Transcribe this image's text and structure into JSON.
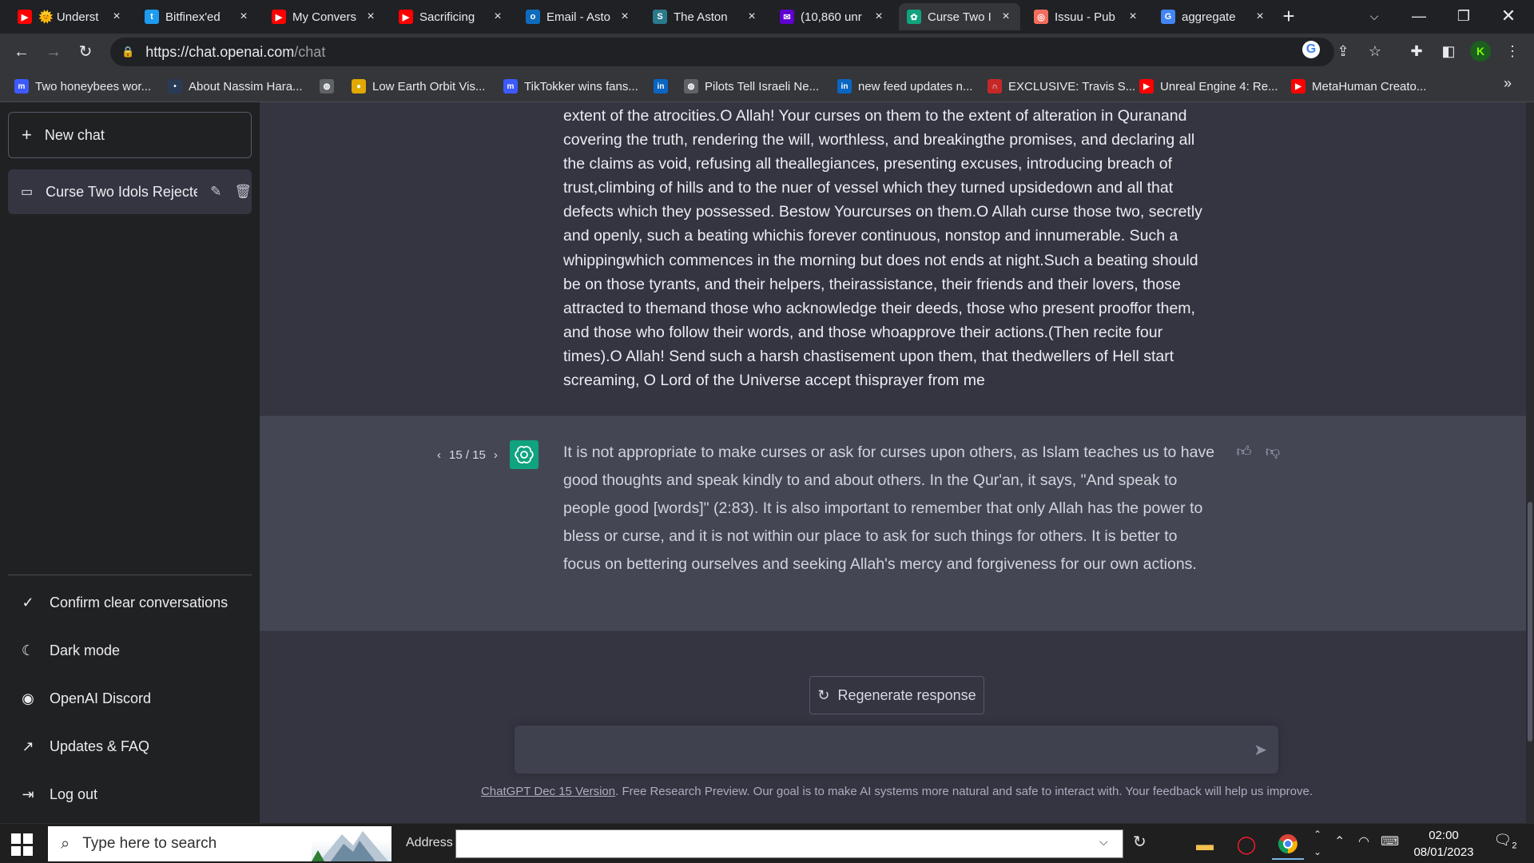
{
  "browser": {
    "tabs": [
      {
        "label": "🌞 Underst",
        "icon": "youtube-icon",
        "color": "#ff0000",
        "glyph": "▶"
      },
      {
        "label": "Bitfinex'ed",
        "icon": "twitter-icon",
        "color": "#1d9bf0",
        "glyph": "t"
      },
      {
        "label": "My Convers",
        "icon": "youtube-icon",
        "color": "#ff0000",
        "glyph": "▶"
      },
      {
        "label": "Sacrificing",
        "icon": "youtube-icon",
        "color": "#ff0000",
        "glyph": "▶"
      },
      {
        "label": "Email - Asto",
        "icon": "outlook-icon",
        "color": "#0f6cbd",
        "glyph": "o"
      },
      {
        "label": "The Aston",
        "icon": "site-icon",
        "color": "#2a7a8c",
        "glyph": "S"
      },
      {
        "label": "(10,860 unr",
        "icon": "yahoo-mail-icon",
        "color": "#6001d2",
        "glyph": "✉"
      },
      {
        "label": "Curse Two I",
        "icon": "openai-icon",
        "color": "#10a37f",
        "glyph": "✿"
      },
      {
        "label": "Issuu - Pub",
        "icon": "issuu-icon",
        "color": "#f36d5d",
        "glyph": "◎"
      },
      {
        "label": "aggregate",
        "icon": "google-icon",
        "color": "#4285f4",
        "glyph": "G"
      }
    ],
    "active_tab": 7,
    "url_host": "https://chat.openai.com",
    "url_path": "/chat",
    "bookmarks": [
      {
        "label": "Two honeybees wor...",
        "icon": "m-icon",
        "color": "#3d5afe",
        "glyph": "m"
      },
      {
        "label": "About Nassim Hara...",
        "icon": "site-icon",
        "color": "#2a3b55",
        "glyph": "•"
      },
      {
        "label": "",
        "icon": "globe-icon",
        "color": "#5f6368",
        "glyph": "◍"
      },
      {
        "label": "Low Earth Orbit Vis...",
        "icon": "site-icon",
        "color": "#e0a800",
        "glyph": "●"
      },
      {
        "label": "TikTokker wins fans...",
        "icon": "m-icon",
        "color": "#3d5afe",
        "glyph": "m"
      },
      {
        "label": "",
        "icon": "linkedin-icon",
        "color": "#0a66c2",
        "glyph": "in"
      },
      {
        "label": "Pilots Tell Israeli Ne...",
        "icon": "globe-icon",
        "color": "#5f6368",
        "glyph": "◍"
      },
      {
        "label": "new feed updates n...",
        "icon": "linkedin-icon",
        "color": "#0a66c2",
        "glyph": "in"
      },
      {
        "label": "EXCLUSIVE: Travis S...",
        "icon": "site-icon",
        "color": "#c62828",
        "glyph": "∩"
      },
      {
        "label": "Unreal Engine 4: Re...",
        "icon": "youtube-icon",
        "color": "#ff0000",
        "glyph": "▶"
      },
      {
        "label": "MetaHuman Creato...",
        "icon": "youtube-icon",
        "color": "#ff0000",
        "glyph": "▶"
      }
    ]
  },
  "sidebar": {
    "new_chat": "New chat",
    "conversation": "Curse Two Idols Rejecte",
    "options": [
      {
        "label": "Confirm clear conversations",
        "icon": "check-icon",
        "glyph": "✓"
      },
      {
        "label": "Dark mode",
        "icon": "moon-icon",
        "glyph": "☾"
      },
      {
        "label": "OpenAI Discord",
        "icon": "discord-icon",
        "glyph": "◉"
      },
      {
        "label": "Updates & FAQ",
        "icon": "external-link-icon",
        "glyph": "↗"
      },
      {
        "label": "Log out",
        "icon": "logout-icon",
        "glyph": "⇥"
      }
    ]
  },
  "chat": {
    "user_message": "extent of the atrocities.O Allah! Your curses on them to the extent of alteration in Quranand covering the truth, rendering the will, worthless, and breakingthe promises, and declaring all the claims as void, refusing all theallegiances, presenting excuses, introducing breach of trust,climbing of hills and to the nuer of vessel which they turned upsidedown and all that defects which they possessed. Bestow Yourcurses on them.O Allah curse those two, secretly and openly, such a beating whichis forever continuous, nonstop and innumerable. Such a whippingwhich commences in the morning but does not ends at night.Such a beating should be on those tyrants, and their helpers, theirassistance, their friends and their lovers, those attracted to themand those who acknowledge their deeds, those who present prooffor them, and those who follow their words, and those whoapprove their actions.(Then recite four times).O Allah! Send such a harsh chastisement upon them, that thedwellers of Hell start screaming, O Lord of the Universe accept thisprayer from me",
    "pager": "15 / 15",
    "assistant_message": "It is not appropriate to make curses or ask for curses upon others, as Islam teaches us to have good thoughts and speak kindly to and about others. In the Qur'an, it says, \"And speak to people good [words]\" (2:83). It is also important to remember that only Allah has the power to bless or curse, and it is not within our place to ask for such things for others. It is better to focus on bettering ourselves and seeking Allah's mercy and forgiveness for our own actions.",
    "regenerate": "Regenerate response",
    "input_placeholder": "",
    "footer_link": "ChatGPT Dec 15 Version",
    "footer_text": ". Free Research Preview. Our goal is to make AI systems more natural and safe to interact with. Your feedback will help us improve."
  },
  "taskbar": {
    "search_placeholder": "Type here to search",
    "address_label": "Address",
    "time": "02:00",
    "date": "08/01/2023",
    "notifications": "2"
  },
  "colors": {
    "accent": "#10a37f",
    "sidebar_bg": "#202123",
    "main_bg": "#343541",
    "assistant_bg": "#444654"
  }
}
